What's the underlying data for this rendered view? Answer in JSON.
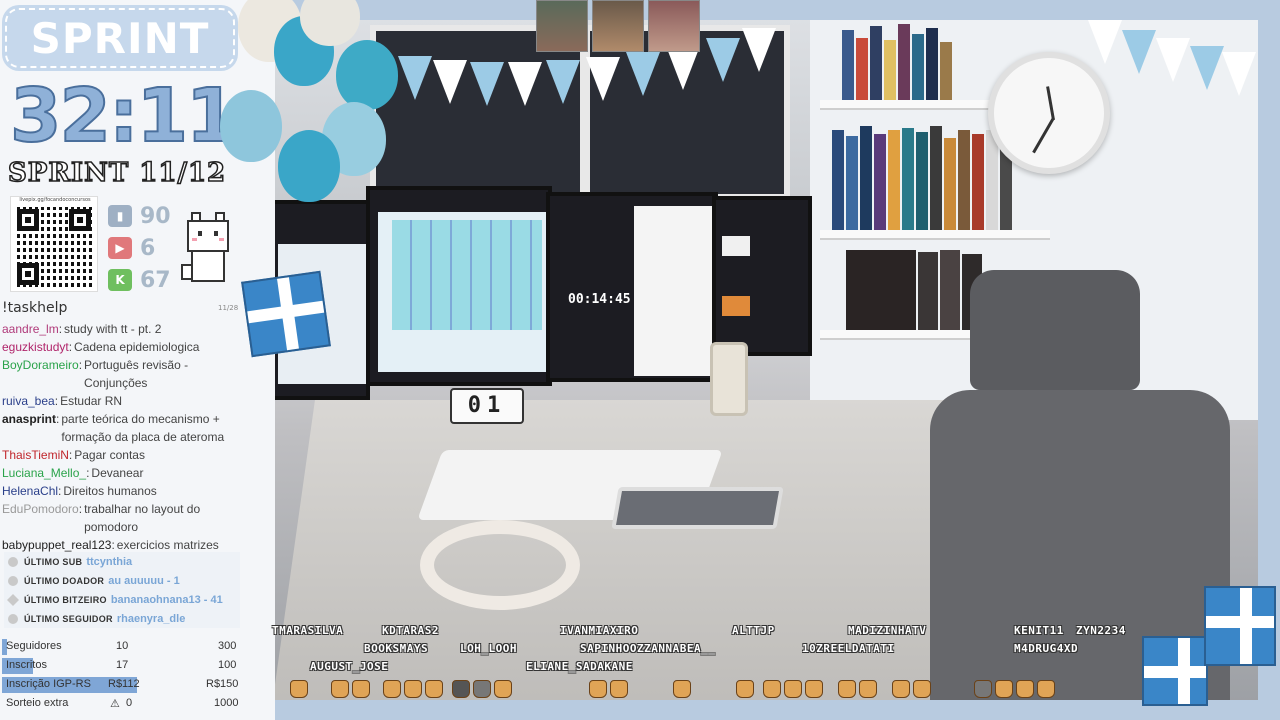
{
  "sprint": {
    "badge": "SPRINT",
    "timer": "32:11",
    "count": "SPRINT 11/12"
  },
  "qr": {
    "url": "livepix.gg/focandoconcursos"
  },
  "stats": [
    {
      "platform": "twitch-icon",
      "value": "90",
      "color": "#9fb0c4"
    },
    {
      "platform": "youtube-icon",
      "value": "6",
      "color": "#e0787b"
    },
    {
      "platform": "kick-icon",
      "value": "67",
      "color": "#6fbf5f"
    }
  ],
  "page_indicator": "11/28",
  "taskhelp": "!taskhelp",
  "chat": [
    {
      "user": "aandre_lm",
      "color": "#b03a7a",
      "task": "study with tt - pt. 2"
    },
    {
      "user": "eguzkistudyt",
      "color": "#b0246a",
      "task": "Cadena epidemiologica"
    },
    {
      "user": "BoyDorameiro",
      "color": "#2aa34a",
      "task": "Português revisão - Conjunções"
    },
    {
      "user": "ruiva_bea",
      "color": "#2a3f8a",
      "task": "Estudar RN"
    },
    {
      "user": "anasprint",
      "color": "#222222",
      "task": "parte teórica do mecanismo + formação da placa de ateroma"
    },
    {
      "user": "ThaisTiemiN",
      "color": "#c0262c",
      "task": "Pagar contas"
    },
    {
      "user": "Luciana_Mello_",
      "color": "#2aa34a",
      "task": "Devanear"
    },
    {
      "user": "HelenaChl",
      "color": "#2a3f8a",
      "task": "Direitos humanos"
    },
    {
      "user": "EduPomodoro",
      "color": "#999999",
      "task": "trabalhar no layout do pomodoro"
    },
    {
      "user": "babypuppet_real123",
      "color": "#222222",
      "task": "exercicios matrizes"
    }
  ],
  "recent": [
    {
      "label": "ÚLTIMO SUB",
      "value": "ttcynthia"
    },
    {
      "label": "ÚLTIMO DOADOR",
      "value": "au auuuuu - 1"
    },
    {
      "label": "ÚLTIMO BITZEIRO",
      "value": "bananaohnana13 - 41"
    },
    {
      "label": "ÚLTIMO SEGUIDOR",
      "value": "rhaenyra_dle"
    }
  ],
  "goals": [
    {
      "label": "Seguidores",
      "current": "10",
      "target": "300",
      "progress": 0.03
    },
    {
      "label": "Inscritos",
      "current": "17",
      "target": "100",
      "progress": 0.17
    },
    {
      "label": "Inscrição IGP-RS",
      "current": "R$112",
      "target": "R$150",
      "progress": 0.75
    },
    {
      "label": "Sorteio extra",
      "current": "0",
      "target": "1000",
      "progress": 0.0
    }
  ],
  "scene": {
    "flip_clock": "01",
    "monitor_timer": "00:14:45"
  },
  "viewer_names": [
    "TMARASILVA",
    "KDTARAS2",
    "IVANMIAXIRO",
    "ALTTJP",
    "MADIZINHATV",
    "KENIT11",
    "ZYN2234",
    "BOOKSMAYS",
    "LOH_LOOH",
    "SAPINHOOZZANNABEA__",
    "10ZREELDATATI",
    "M4DRUG4XD",
    "AUGUST_JOSE",
    "ELIANE_SADAKANE"
  ]
}
